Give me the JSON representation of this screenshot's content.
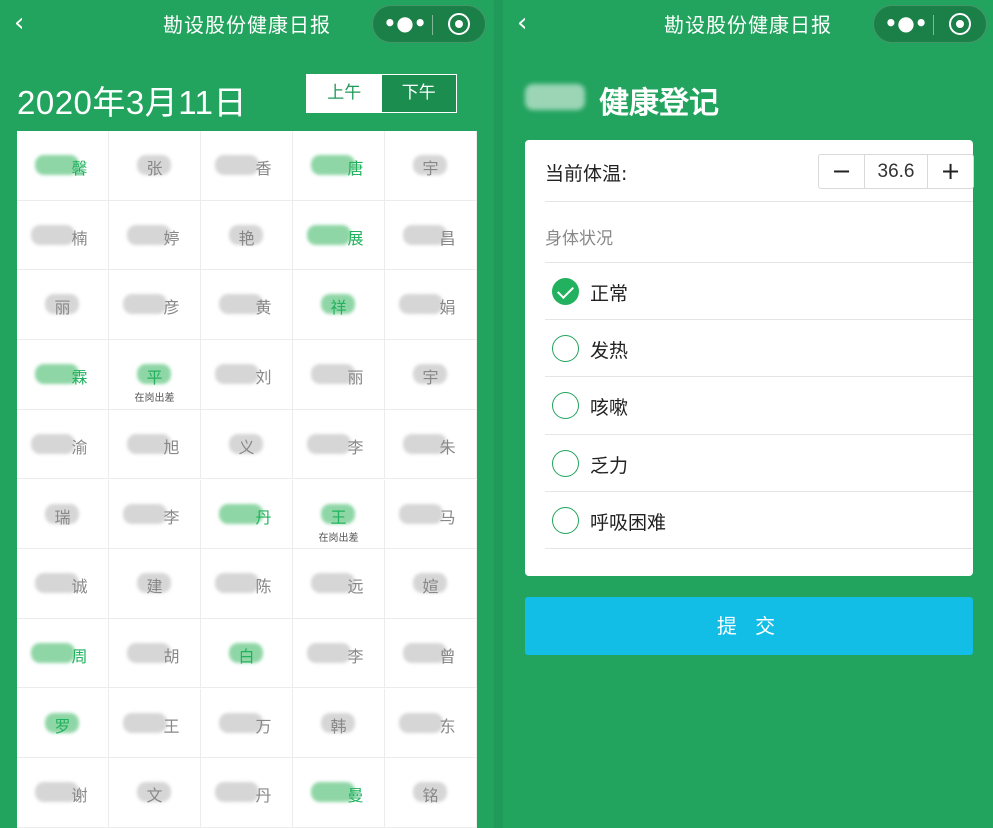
{
  "left": {
    "nav": {
      "title": "勘设股份健康日报",
      "back_icon": "chevron-left-icon",
      "more_glyph": "•●•"
    },
    "date": "2020年3月11日",
    "segment": {
      "am": "上午",
      "pm": "下午",
      "selected": "下午"
    },
    "grid": [
      [
        "馨",
        "张",
        "香",
        "唐",
        "宇"
      ],
      [
        "楠",
        "婷",
        "艳",
        "展",
        "昌"
      ],
      [
        "丽",
        "彦",
        "黄",
        "祥",
        "娟"
      ],
      [
        "霖",
        "平",
        "刘",
        "丽",
        "宇"
      ],
      [
        "渝",
        "旭",
        "义",
        "李",
        "朱"
      ],
      [
        "瑞",
        "李",
        "丹",
        "王",
        "马"
      ],
      [
        "诚",
        "建",
        "陈",
        "远",
        "媗"
      ],
      [
        "周",
        "胡",
        "白",
        "李",
        "曾"
      ],
      [
        "罗",
        "王",
        "万",
        "韩",
        "东"
      ],
      [
        "谢",
        "文",
        "丹",
        "曼",
        "铭"
      ]
    ],
    "green_cells": [
      "0-0",
      "0-3",
      "1-3",
      "2-3",
      "3-0",
      "3-1",
      "5-2",
      "5-3",
      "7-0",
      "7-2",
      "8-0",
      "9-3"
    ],
    "sub_labels": {
      "3-1": "在岗出差",
      "5-3": "在岗出差"
    }
  },
  "right": {
    "nav": {
      "title": "勘设股份健康日报",
      "back_icon": "chevron-left-icon",
      "more_glyph": "•●•"
    },
    "title": "健康登记",
    "temperature": {
      "label": "当前体温:",
      "value": "36.6",
      "minus": "−",
      "plus": "+"
    },
    "condition": {
      "label": "身体状况",
      "options": [
        "正常",
        "发热",
        "咳嗽",
        "乏力",
        "呼吸困难"
      ],
      "selected": "正常"
    },
    "submit": "提 交"
  }
}
